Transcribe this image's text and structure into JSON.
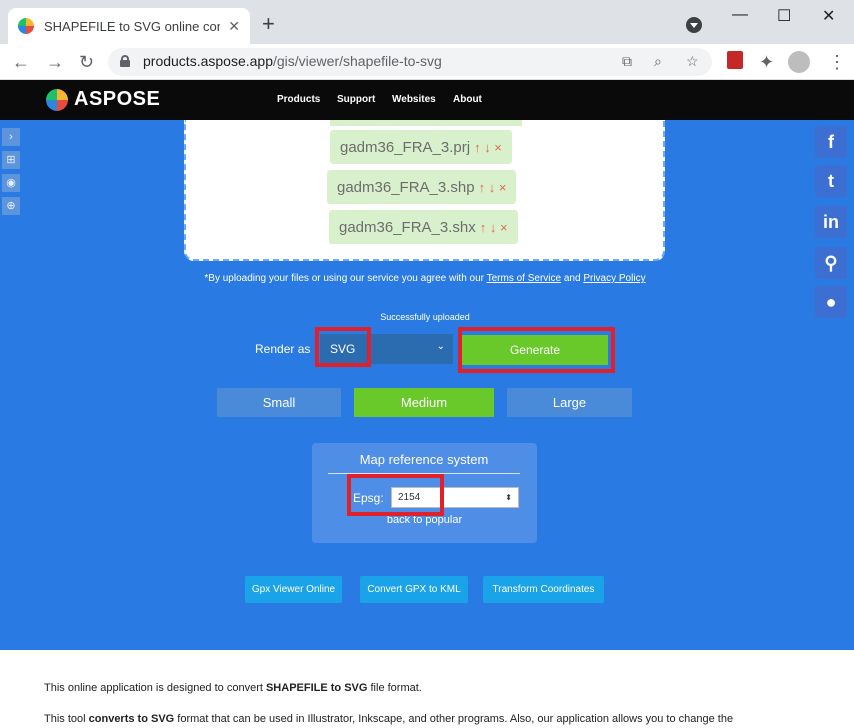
{
  "browser": {
    "tab_title": "SHAPEFILE to SVG online convert",
    "tab_close": "✕",
    "new_tab": "+",
    "url_host": "products.aspose.app",
    "url_path": "/gis/viewer/shapefile-to-svg",
    "win_min": "—",
    "win_max": "☐",
    "win_close": "✕"
  },
  "site": {
    "logo_text": "ASPOSE",
    "nav": [
      "Products",
      "Support",
      "Websites",
      "About"
    ]
  },
  "files": [
    {
      "name": "gadm36_FRA_3.prj",
      "controls": "↑ ↓ ×"
    },
    {
      "name": "gadm36_FRA_3.shp",
      "controls": "↑ ↓ ×"
    },
    {
      "name": "gadm36_FRA_3.shx",
      "controls": "↑ ↓ ×"
    }
  ],
  "terms": {
    "prefix": "*By uploading your files or using our service you agree with our ",
    "tos": "Terms of Service",
    "and": " and ",
    "privacy": "Privacy Policy"
  },
  "status_text": "Successfully uploaded",
  "render": {
    "label": "Render as",
    "selected": "SVG",
    "generate": "Generate"
  },
  "sizes": [
    "Small",
    "Medium",
    "Large"
  ],
  "sizes_selected": "Medium",
  "map_ref": {
    "title": "Map reference system",
    "epsg_label": "Epsg:",
    "epsg_value": "2154",
    "back_link": "back to popular"
  },
  "links": [
    "Gpx Viewer Online",
    "Convert GPX to KML",
    "Transform Coordinates"
  ],
  "footer": {
    "line1_pre": "This online application is designed to convert ",
    "line1_bold": "SHAPEFILE to SVG",
    "line1_post": " file format.",
    "line2_pre": "This tool ",
    "line2_bold": "converts to SVG",
    "line2_post": " format that can be used in Illustrator, Inkscape, and other programs. Also, our application allows you to change the"
  },
  "colors": {
    "main_bg": "#2a7ae4",
    "generate": "#6ac92a",
    "highlight": "#e0202b",
    "size_button": "#4a8bd9",
    "size_selected": "#6ac92a",
    "link_button": "#1aa3e8"
  },
  "icons": {
    "left_tools": [
      "expand-icon",
      "grid-icon",
      "eye-icon",
      "zoom-icon"
    ],
    "social": [
      "facebook-icon",
      "twitter-icon",
      "linkedin-icon",
      "location-icon",
      "github-icon"
    ]
  }
}
